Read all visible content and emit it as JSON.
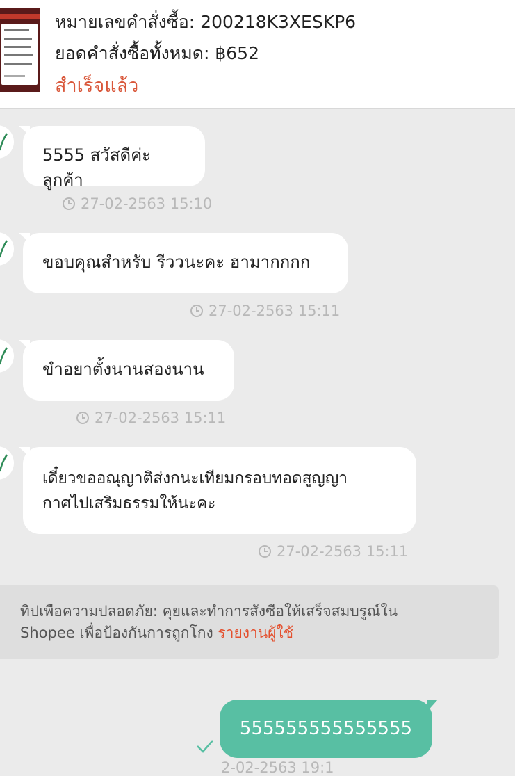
{
  "order": {
    "order_number": "หมายเลขคำสั่งซื้อ: 200218K3XESKP6",
    "order_total": "ยอดคำสั่งซื้อทั้งหมด: ฿652",
    "status": "สำเร็จแล้ว"
  },
  "messages": [
    {
      "text": "5555 สวัสดีค่ะลูกค้า",
      "time": "27-02-2563 15:10"
    },
    {
      "text": "ขอบคุณสำหรับ รีววนะคะ ฮามากกกก",
      "time": "27-02-2563 15:11"
    },
    {
      "text": "ขำอยาตั้งนานสองนาน",
      "time": "27-02-2563 15:11"
    },
    {
      "line1": "เดี๋ยวขออณุญาติส่งกนะเทียมกรอบทอดสูญญา",
      "line2": "กาศไปเสริมธรรมให้นะคะ",
      "time": "27-02-2563 15:11"
    }
  ],
  "tip": {
    "line1": "ทิปเพือความปลอดภัย: คุยและทำการสังซือให้เสร็จสมบรูณ์ใน",
    "line2": "Shopee เพื่อป้องกันการถูกโกง",
    "link": "รายงานผู้ใช้"
  },
  "outgoing": {
    "text": "555555555555555",
    "time": "2-02-2563 19:1"
  },
  "colors": {
    "status": "#d9573a",
    "outgoing_bubble": "#58bfa3",
    "link": "#e4502e"
  }
}
